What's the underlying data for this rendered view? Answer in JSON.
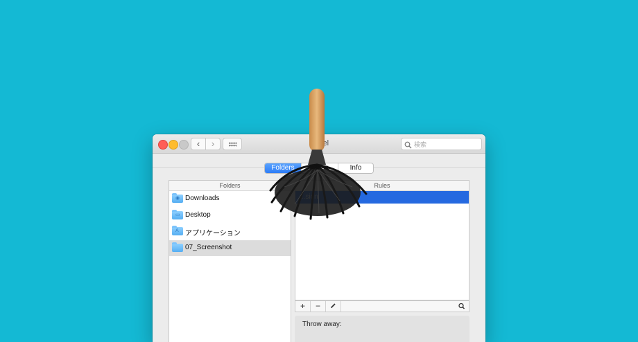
{
  "window": {
    "title": "Hazel",
    "search_placeholder": "検索"
  },
  "tabs": [
    {
      "label": "Folders",
      "selected": true
    },
    {
      "label": "Rules",
      "selected": false
    },
    {
      "label": "Info",
      "selected": false
    }
  ],
  "folders": {
    "header": "Folders",
    "items": [
      {
        "label": "Downloads",
        "icon": "downloads-folder-icon"
      },
      {
        "label": "Desktop",
        "icon": "desktop-folder-icon"
      },
      {
        "label": "アプリケーション",
        "icon": "applications-folder-icon"
      },
      {
        "label": "07_Screenshot",
        "icon": "folder-icon",
        "selected": true
      }
    ]
  },
  "rules": {
    "header": "Rules",
    "items": [
      {
        "label": "...sion",
        "selected": true
      }
    ]
  },
  "rules_toolbar": {
    "add": "+",
    "remove": "−",
    "edit_icon": "pencil-icon",
    "search_icon": "search-icon"
  },
  "throw_away": {
    "label": "Throw away:"
  },
  "colors": {
    "background": "#14b9d4",
    "accent": "#2d7cf6",
    "selection": "#2569e0"
  }
}
